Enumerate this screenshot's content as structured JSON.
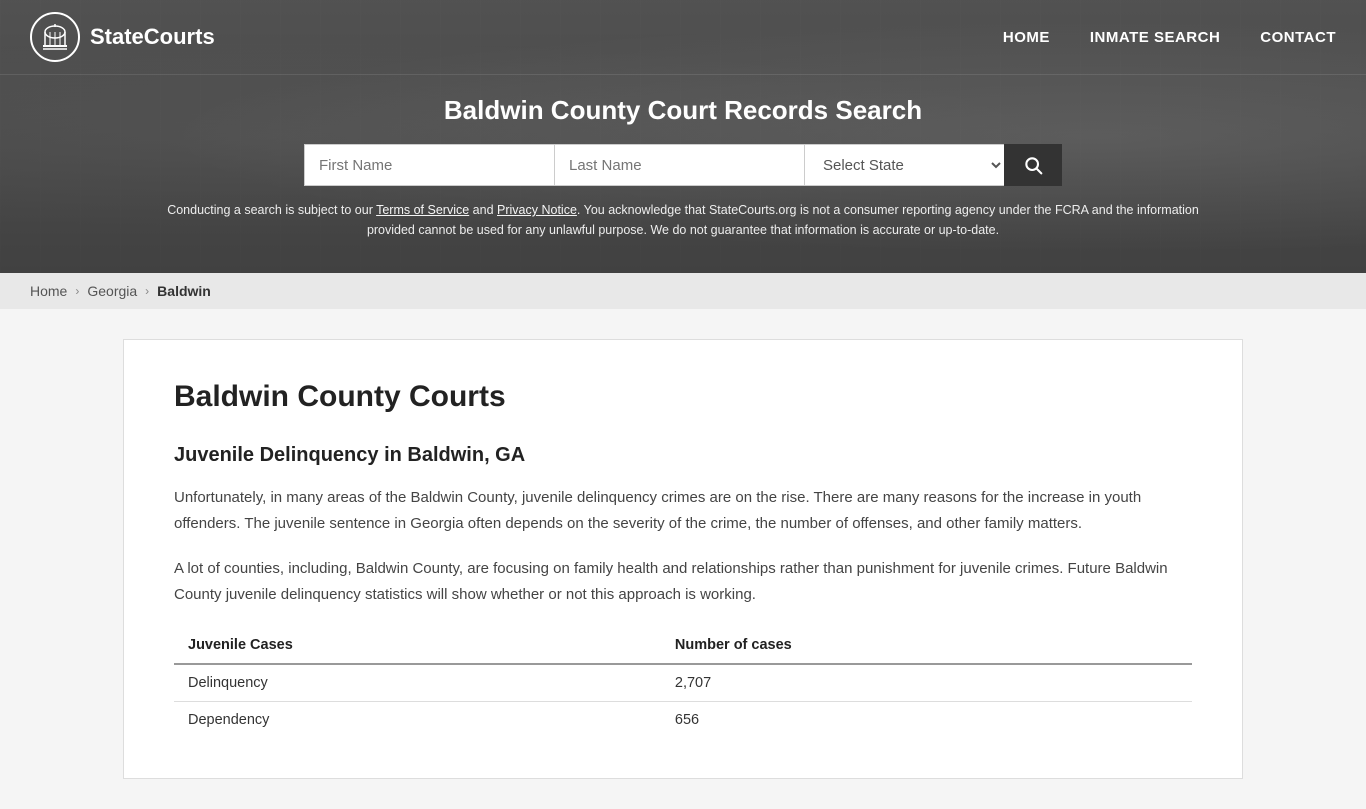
{
  "site": {
    "name": "StateCourts",
    "logo_alt": "StateCourts logo"
  },
  "nav": {
    "home_label": "HOME",
    "inmate_search_label": "INMATE SEARCH",
    "contact_label": "CONTACT"
  },
  "header": {
    "page_title": "Baldwin County Court Records Search",
    "search": {
      "first_name_placeholder": "First Name",
      "last_name_placeholder": "Last Name",
      "state_placeholder": "Select State",
      "search_button_label": "🔍"
    },
    "disclaimer": "Conducting a search is subject to our Terms of Service and Privacy Notice. You acknowledge that StateCourts.org is not a consumer reporting agency under the FCRA and the information provided cannot be used for any unlawful purpose. We do not guarantee that information is accurate or up-to-date."
  },
  "breadcrumb": {
    "home": "Home",
    "state": "Georgia",
    "county": "Baldwin"
  },
  "main": {
    "county_title": "Baldwin County Courts",
    "section_title": "Juvenile Delinquency in Baldwin, GA",
    "paragraph1": "Unfortunately, in many areas of the Baldwin County, juvenile delinquency crimes are on the rise. There are many reasons for the increase in youth offenders. The juvenile sentence in Georgia often depends on the severity of the crime, the number of offenses, and other family matters.",
    "paragraph2": "A lot of counties, including, Baldwin County, are focusing on family health and relationships rather than punishment for juvenile crimes. Future Baldwin County juvenile delinquency statistics will show whether or not this approach is working.",
    "table": {
      "col1_header": "Juvenile Cases",
      "col2_header": "Number of cases",
      "rows": [
        {
          "case_type": "Delinquency",
          "count": "2,707"
        },
        {
          "case_type": "Dependency",
          "count": "656"
        }
      ]
    }
  }
}
